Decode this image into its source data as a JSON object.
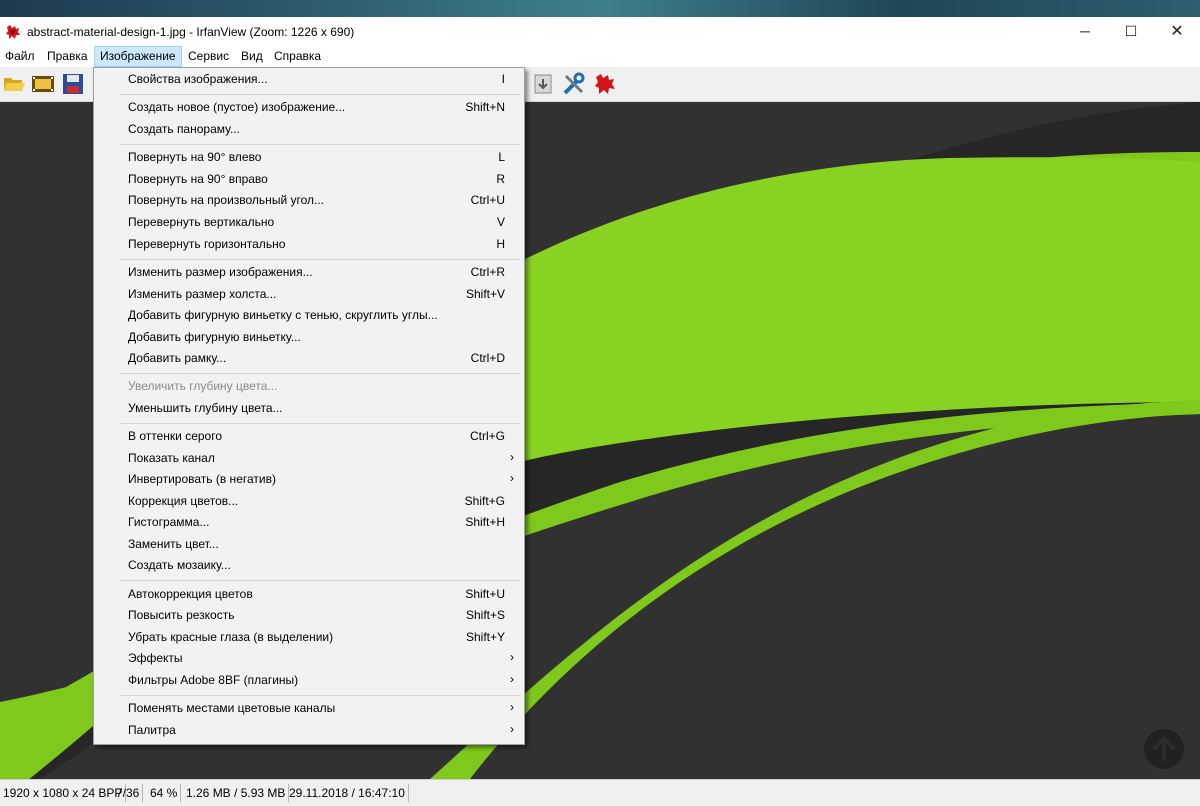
{
  "window": {
    "title": "abstract-material-design-1.jpg - IrfanView (Zoom: 1226 x 690)",
    "app_icon": "irfanview-red-cat-icon",
    "controls": {
      "minimize": "─",
      "maximize": "☐",
      "close": "✕"
    }
  },
  "menubar": {
    "items": [
      {
        "label": "Файл"
      },
      {
        "label": "Правка"
      },
      {
        "label": "Изображение",
        "active": true
      },
      {
        "label": "Сервис"
      },
      {
        "label": "Вид"
      },
      {
        "label": "Справка"
      }
    ]
  },
  "toolbar": {
    "icons": [
      "open-folder-icon",
      "slideshow-icon",
      "save-icon",
      "download-icon",
      "tools-icon",
      "irfanview-logo-icon"
    ]
  },
  "menu": {
    "items": [
      {
        "label": "Свойства изображения...",
        "shortcut": "I"
      },
      {
        "sep": true
      },
      {
        "label": "Создать новое (пустое) изображение...",
        "shortcut": "Shift+N"
      },
      {
        "label": "Создать панораму...",
        "shortcut": ""
      },
      {
        "sep": true
      },
      {
        "label": "Повернуть на 90° влево",
        "shortcut": "L"
      },
      {
        "label": "Повернуть на 90° вправо",
        "shortcut": "R"
      },
      {
        "label": "Повернуть на произвольный угол...",
        "shortcut": "Ctrl+U"
      },
      {
        "label": "Перевернуть вертикально",
        "shortcut": "V"
      },
      {
        "label": "Перевернуть горизонтально",
        "shortcut": "H"
      },
      {
        "sep": true
      },
      {
        "label": "Изменить размер изображения...",
        "shortcut": "Ctrl+R"
      },
      {
        "label": "Изменить размер холста...",
        "shortcut": "Shift+V"
      },
      {
        "label": "Добавить фигурную виньетку с тенью, скруглить углы...",
        "shortcut": ""
      },
      {
        "label": "Добавить фигурную виньетку...",
        "shortcut": ""
      },
      {
        "label": "Добавить рамку...",
        "shortcut": "Ctrl+D"
      },
      {
        "sep": true
      },
      {
        "label": "Увеличить глубину цвета...",
        "shortcut": "",
        "disabled": true
      },
      {
        "label": "Уменьшить глубину цвета...",
        "shortcut": ""
      },
      {
        "sep": true
      },
      {
        "label": "В оттенки серого",
        "shortcut": "Ctrl+G"
      },
      {
        "label": "Показать канал",
        "shortcut": "",
        "submenu": true
      },
      {
        "label": "Инвертировать (в негатив)",
        "shortcut": "",
        "submenu": true
      },
      {
        "label": "Коррекция цветов...",
        "shortcut": "Shift+G"
      },
      {
        "label": "Гистограмма...",
        "shortcut": "Shift+H"
      },
      {
        "label": "Заменить цвет...",
        "shortcut": ""
      },
      {
        "label": "Создать мозаику...",
        "shortcut": ""
      },
      {
        "sep": true
      },
      {
        "label": "Автокоррекция цветов",
        "shortcut": "Shift+U"
      },
      {
        "label": "Повысить резкость",
        "shortcut": "Shift+S"
      },
      {
        "label": "Убрать красные глаза (в выделении)",
        "shortcut": "Shift+Y"
      },
      {
        "label": "Эффекты",
        "shortcut": "",
        "submenu": true
      },
      {
        "label": "Фильтры Adobe 8BF (плагины)",
        "shortcut": "",
        "submenu": true
      },
      {
        "sep": true
      },
      {
        "label": "Поменять местами цветовые каналы",
        "shortcut": "",
        "submenu": true
      },
      {
        "label": "Палитра",
        "shortcut": "",
        "submenu": true
      }
    ],
    "submenu_arrow": "›"
  },
  "status": {
    "dimensions": "1920 x 1080 x 24 BPP",
    "index": "7/36",
    "zoom": "64 %",
    "size": "1.26 MB / 5.93 MB",
    "datetime": "29.11.2018 / 16:47:10"
  },
  "colors": {
    "accent_green": "#86d11e",
    "dark_bg": "#323232",
    "menu_highlight": "#cce8ff"
  }
}
